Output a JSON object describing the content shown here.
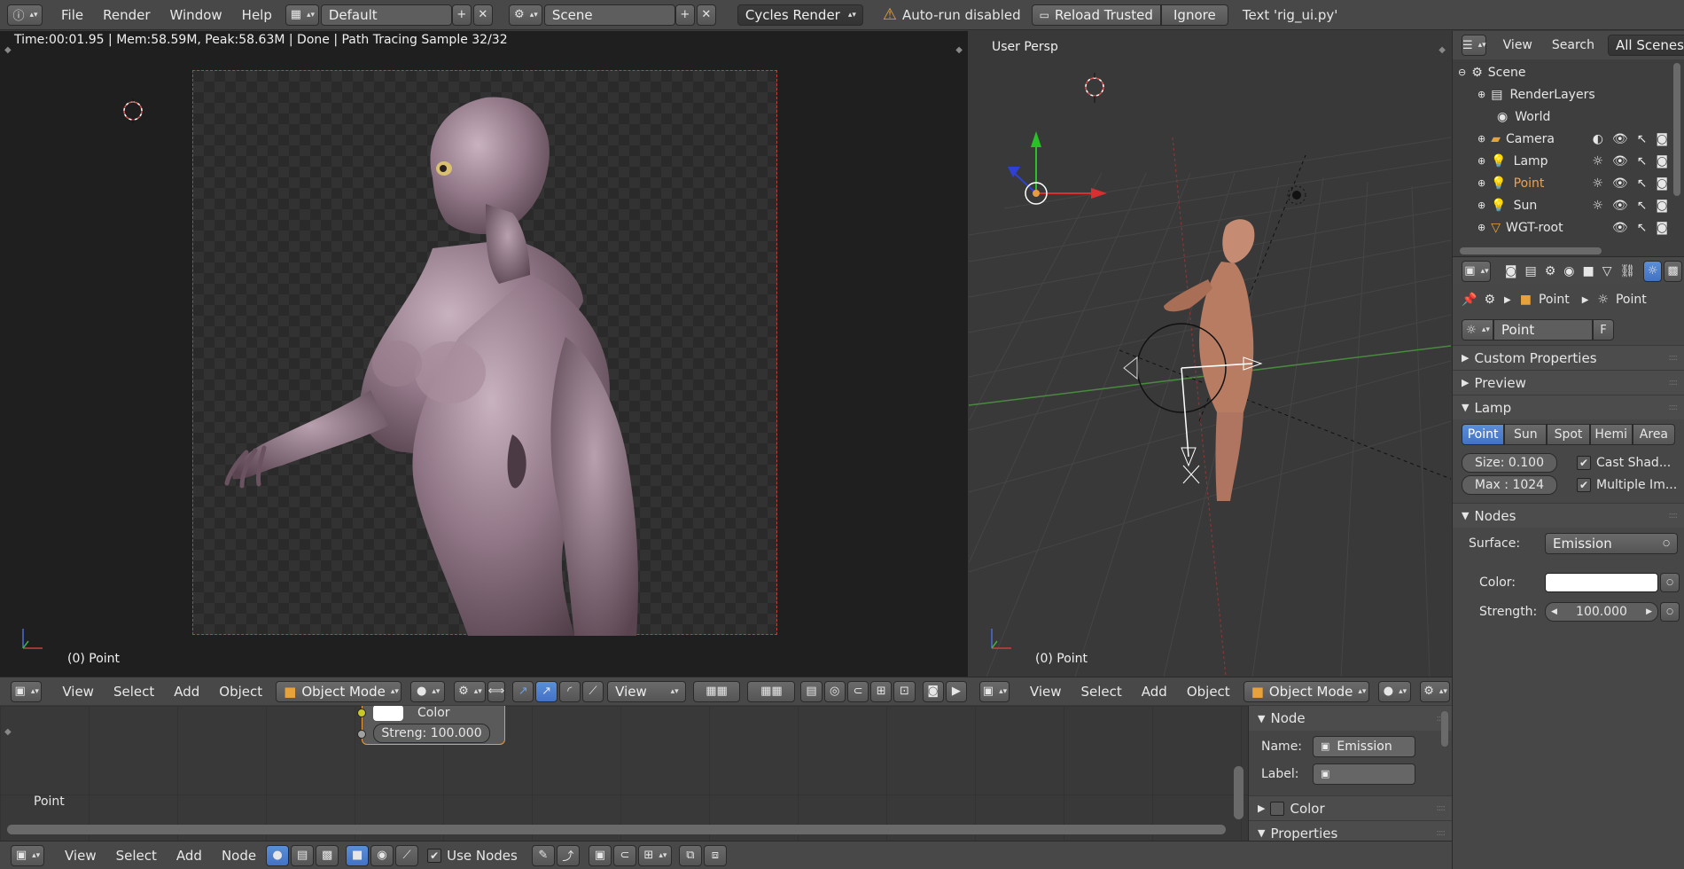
{
  "topbar": {
    "menus": [
      "File",
      "Render",
      "Window",
      "Help"
    ],
    "layout_field": "Default",
    "scene_field": "Scene",
    "engine": "Cycles Render",
    "warning": "Auto-run disabled",
    "reload_button": "Reload Trusted",
    "ignore_button": "Ignore",
    "text_label": "Text 'rig_ui.py'"
  },
  "render_view": {
    "status": "Time:00:01.95 | Mem:58.59M, Peak:58.63M | Done | Path Tracing Sample 32/32",
    "object_label": "(0) Point"
  },
  "viewport": {
    "persp_label": "User Persp",
    "object_label": "(0) Point"
  },
  "render_header": {
    "menus": [
      "View",
      "Select",
      "Add",
      "Object"
    ],
    "mode": "Object Mode",
    "view_dropdown": "View"
  },
  "viewport_header": {
    "menus": [
      "View",
      "Select",
      "Add",
      "Object"
    ],
    "mode": "Object Mode"
  },
  "node_editor": {
    "color_label": "Color",
    "strength_field": "Streng: 100.000",
    "name_label": "Point"
  },
  "node_panel": {
    "title": "Node",
    "name_label": "Name:",
    "name_value": "Emission",
    "label_label": "Label:",
    "color_section": "Color",
    "properties_section": "Properties"
  },
  "bottom_header": {
    "menus": [
      "View",
      "Select",
      "Add",
      "Node"
    ],
    "use_nodes": "Use Nodes"
  },
  "outliner": {
    "menus": [
      "View",
      "Search"
    ],
    "scope": "All Scenes",
    "items": [
      {
        "label": "Scene"
      },
      {
        "label": "RenderLayers"
      },
      {
        "label": "World"
      },
      {
        "label": "Camera"
      },
      {
        "label": "Lamp"
      },
      {
        "label": "Point"
      },
      {
        "label": "Sun"
      },
      {
        "label": "WGT-root"
      }
    ]
  },
  "properties": {
    "breadcrumb_object": "Point",
    "breadcrumb_data": "Point",
    "datablock_name": "Point",
    "fake_user": "F",
    "panels": {
      "custom_properties": "Custom Properties",
      "preview": "Preview",
      "lamp": "Lamp",
      "nodes": "Nodes"
    },
    "lamp_types": [
      "Point",
      "Sun",
      "Spot",
      "Hemi",
      "Area"
    ],
    "active_lamp_type": "Point",
    "size_field": "Size:  0.100",
    "max_field": "Max : 1024",
    "cast_shadow": "Cast Shad...",
    "multiple_importance": "Multiple Im...",
    "surface_label": "Surface:",
    "surface_value": "Emission",
    "color_label": "Color:",
    "strength_label": "Strength:",
    "strength_value": "100.000"
  },
  "colors": {
    "accent_blue": "#5680c2",
    "lamp_swatch": "#ffffff",
    "selection_orange": "#e89a3c"
  }
}
